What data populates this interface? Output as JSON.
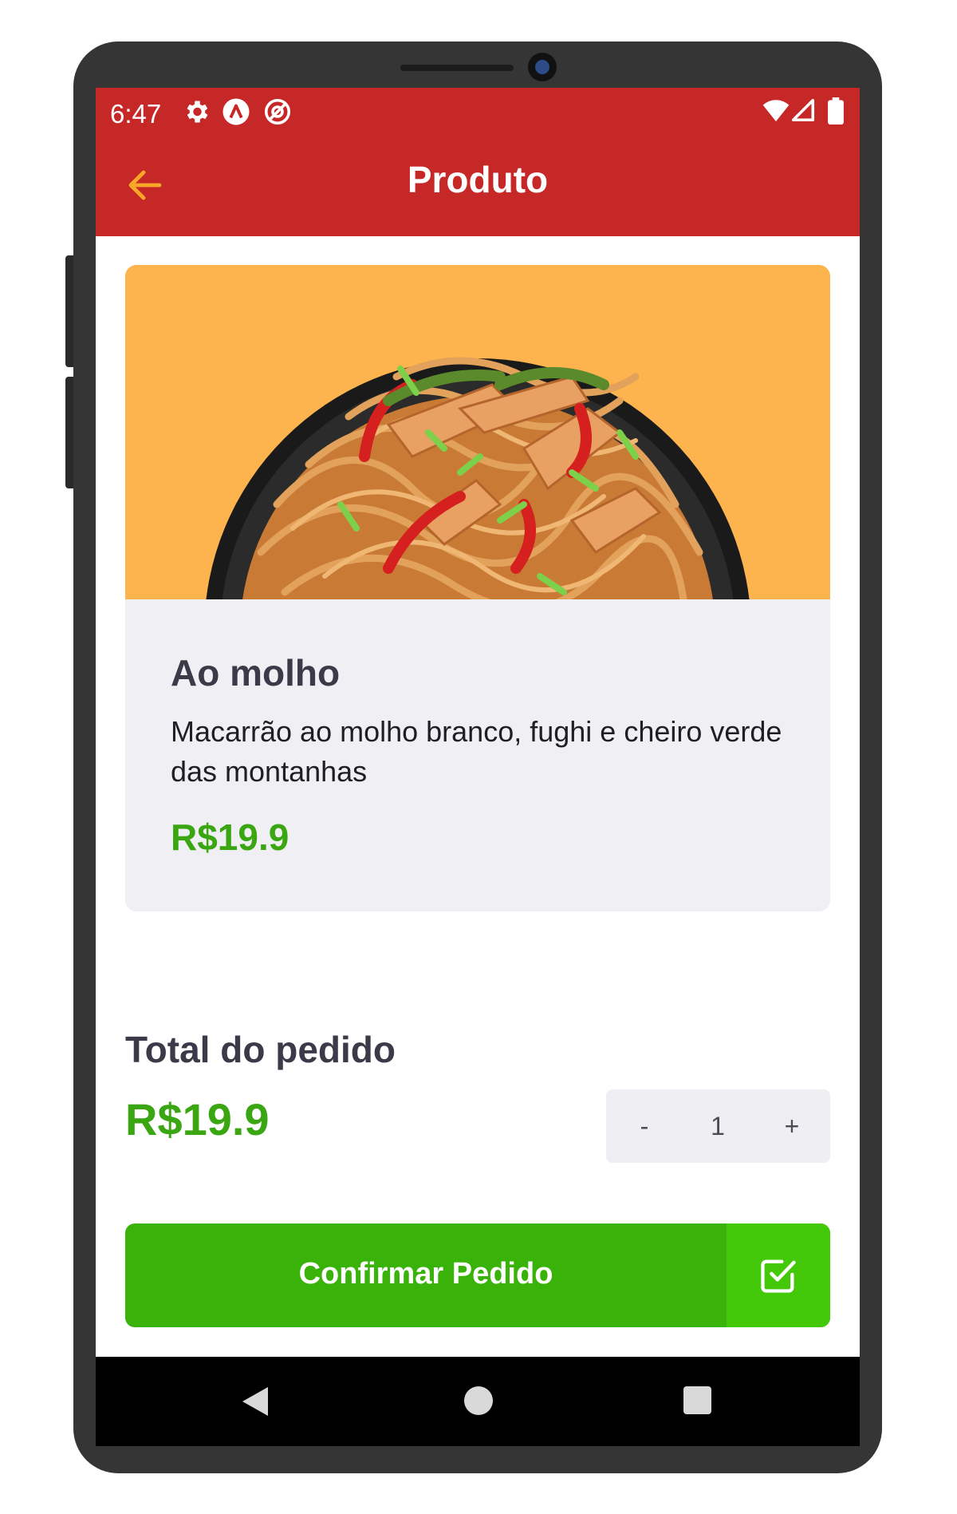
{
  "status_bar": {
    "time": "6:47",
    "left_icons": [
      "settings-icon",
      "app-a-icon",
      "app-at-icon"
    ],
    "right_icons": [
      "wifi-icon",
      "signal-icon",
      "battery-icon"
    ]
  },
  "header": {
    "title": "Produto",
    "back_icon": "arrow-left-icon"
  },
  "product": {
    "image": "noodles-bowl-image",
    "name": "Ao molho",
    "description": "Macarrão ao molho branco, fughi e cheiro verde das montanhas",
    "price": "R$19.9"
  },
  "order": {
    "total_label": "Total do pedido",
    "total_value": "R$19.9",
    "quantity": {
      "minus_label": "-",
      "value": "1",
      "plus_label": "+"
    },
    "confirm_label": "Confirmar Pedido",
    "confirm_icon": "check-square-icon"
  },
  "nav_bar": {
    "icons": [
      "nav-back-icon",
      "nav-home-icon",
      "nav-recent-icon"
    ]
  },
  "colors": {
    "header_red": "#c62828",
    "accent_orange": "#fdb44f",
    "price_green": "#3aa612",
    "button_green": "#39b20a",
    "button_green_light": "#44c80a"
  }
}
